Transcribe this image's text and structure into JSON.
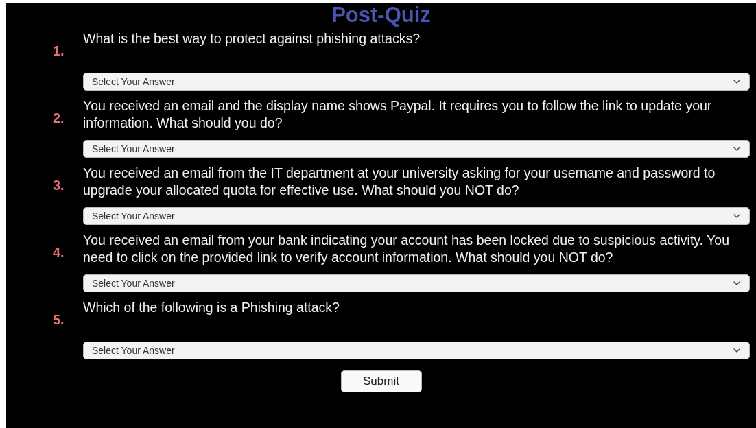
{
  "title": "Post-Quiz",
  "questions": [
    {
      "number": "1.",
      "text": "What is the best way to protect against phishing attacks?",
      "answer": {
        "placeholder": "Select Your Answer"
      }
    },
    {
      "number": "2.",
      "text": "You received an email and the display name shows Paypal.  It requires you to follow the link to update your information. What should you do?",
      "answer": {
        "placeholder": "Select Your Answer"
      }
    },
    {
      "number": "3.",
      "text": "You received an email from the IT department at your university asking for your username and password to upgrade your allocated quota for effective use. What should you NOT do?",
      "answer": {
        "placeholder": "Select Your Answer"
      }
    },
    {
      "number": "4.",
      "text": "You received an email from your bank indicating your account has been locked due to suspicious activity. You need to click on the provided link to verify account information. What should you NOT do?",
      "answer": {
        "placeholder": "Select Your Answer"
      }
    },
    {
      "number": "5.",
      "text": "Which of the following is a Phishing attack?",
      "answer": {
        "placeholder": "Select Your Answer"
      }
    }
  ],
  "submit": "Submit"
}
